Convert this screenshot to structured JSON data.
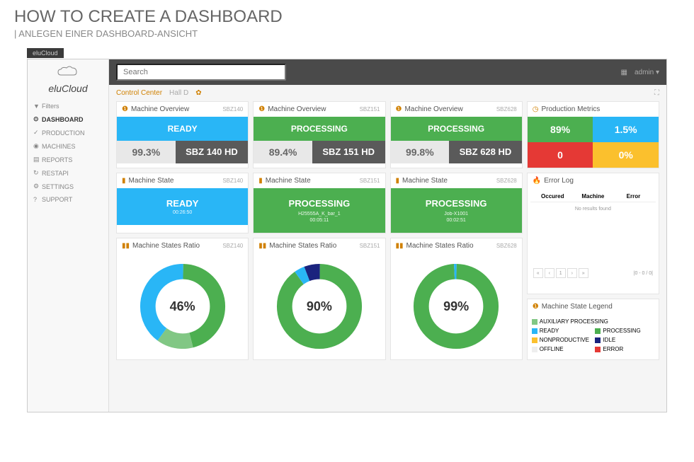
{
  "page": {
    "title": "HOW TO CREATE A DASHBOARD",
    "subtitle": "| ANLEGEN EINER DASHBOARD-ANSICHT"
  },
  "browser_tab": "eluCloud",
  "logo": "eluCloud",
  "sidebar": {
    "items": [
      {
        "icon": "▼",
        "label": "Filters"
      },
      {
        "icon": "⊙",
        "label": "DASHBOARD"
      },
      {
        "icon": "✓",
        "label": "PRODUCTION"
      },
      {
        "icon": "◉",
        "label": "MACHINES"
      },
      {
        "icon": "▤",
        "label": "REPORTS"
      },
      {
        "icon": "↻",
        "label": "RESTAPI"
      },
      {
        "icon": "⚙",
        "label": "SETTINGS"
      },
      {
        "icon": "?",
        "label": "SUPPORT"
      }
    ]
  },
  "search": {
    "placeholder": "Search"
  },
  "topbar": {
    "user_label": "admin ▾"
  },
  "tabs": {
    "tab1": "Control Center",
    "tab2": "Hall D"
  },
  "cards": {
    "overview1": {
      "title": "Machine Overview",
      "code": "SBZ140",
      "status": "READY",
      "pct": "99.3%",
      "name": "SBZ 140 HD"
    },
    "overview2": {
      "title": "Machine Overview",
      "code": "SBZ151",
      "status": "PROCESSING",
      "pct": "89.4%",
      "name": "SBZ 151 HD"
    },
    "overview3": {
      "title": "Machine Overview",
      "code": "SBZ628",
      "status": "PROCESSING",
      "pct": "99.8%",
      "name": "SBZ 628 HD"
    },
    "metrics": {
      "title": "Production Metrics",
      "v1": "89%",
      "v2": "1.5%",
      "v3": "0",
      "v4": "0%"
    },
    "state1": {
      "title": "Machine State",
      "code": "SBZ140",
      "status": "READY",
      "sub": "",
      "time": "00:26:50"
    },
    "state2": {
      "title": "Machine State",
      "code": "SBZ151",
      "status": "PROCESSING",
      "sub": "H25555A_K_bar_1",
      "time": "00:05:11"
    },
    "state3": {
      "title": "Machine State",
      "code": "SBZ628",
      "status": "PROCESSING",
      "sub": "Job-X1001",
      "time": "00:02:51"
    },
    "errorlog": {
      "title": "Error Log",
      "col1": "Occured",
      "col2": "Machine",
      "col3": "Error",
      "empty": "No results found",
      "pager_info": "|0 - 0 / 0|"
    },
    "ratio1": {
      "title": "Machine States Ratio",
      "code": "SBZ140",
      "center": "46%"
    },
    "ratio2": {
      "title": "Machine States Ratio",
      "code": "SBZ151",
      "center": "90%"
    },
    "ratio3": {
      "title": "Machine States Ratio",
      "code": "SBZ628",
      "center": "99%"
    },
    "legend": {
      "title": "Machine State Legend",
      "aux": "AUXILIARY PROCESSING",
      "ready": "READY",
      "proc": "PROCESSING",
      "nonprod": "NONPRODUCTIVE",
      "idle": "IDLE",
      "offline": "OFFLINE",
      "error": "ERROR"
    }
  },
  "chart_data": [
    {
      "type": "pie",
      "title": "Machine States Ratio SBZ140",
      "center_label": "46%",
      "series": [
        {
          "name": "PROCESSING",
          "value": 46,
          "color": "#4caf50"
        },
        {
          "name": "AUXILIARY PROCESSING",
          "value": 14,
          "color": "#81c784"
        },
        {
          "name": "READY",
          "value": 40,
          "color": "#29b6f6"
        }
      ]
    },
    {
      "type": "pie",
      "title": "Machine States Ratio SBZ151",
      "center_label": "90%",
      "series": [
        {
          "name": "PROCESSING",
          "value": 90,
          "color": "#4caf50"
        },
        {
          "name": "READY",
          "value": 4,
          "color": "#29b6f6"
        },
        {
          "name": "IDLE",
          "value": 6,
          "color": "#1a237e"
        }
      ]
    },
    {
      "type": "pie",
      "title": "Machine States Ratio SBZ628",
      "center_label": "99%",
      "series": [
        {
          "name": "PROCESSING",
          "value": 99,
          "color": "#4caf50"
        },
        {
          "name": "READY",
          "value": 1,
          "color": "#29b6f6"
        }
      ]
    }
  ]
}
